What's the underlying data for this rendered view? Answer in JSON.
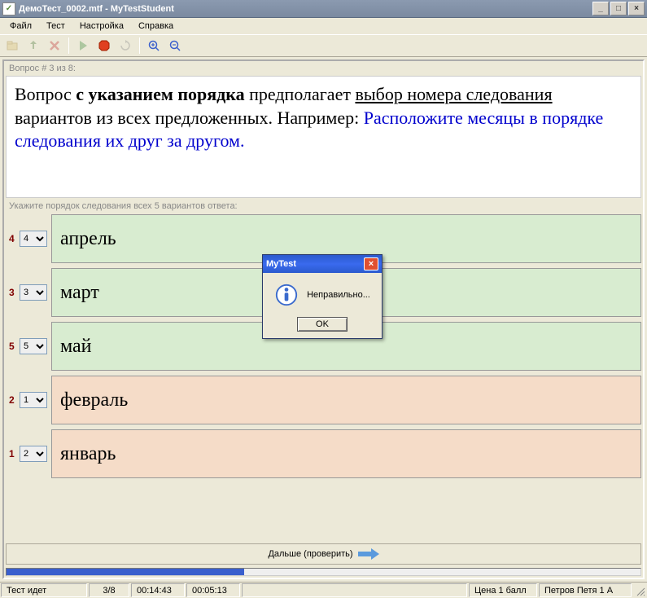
{
  "window": {
    "title": "ДемоТест_0002.mtf - MyTestStudent"
  },
  "menu": {
    "file": "Файл",
    "test": "Тест",
    "settings": "Настройка",
    "help": "Справка"
  },
  "question": {
    "counter": "Вопрос # 3 из 8:",
    "part1": "Вопрос ",
    "bold": "с указанием порядка",
    "part2": " предполагает ",
    "uline1": "выбор номера следования",
    "part3": " вариантов из всех предложенных. Например: ",
    "blue": "Расположите месяцы в порядке следования их друг за другом.",
    "instruction": "Укажите порядок следования всех 5 вариантов ответа:"
  },
  "answers": [
    {
      "idx": "4",
      "val": "4",
      "text": "апрель",
      "correct": true
    },
    {
      "idx": "3",
      "val": "3",
      "text": "март",
      "correct": true
    },
    {
      "idx": "5",
      "val": "5",
      "text": "май",
      "correct": true
    },
    {
      "idx": "2",
      "val": "1",
      "text": "февраль",
      "correct": false
    },
    {
      "idx": "1",
      "val": "2",
      "text": "январь",
      "correct": false
    }
  ],
  "next_button": "Дальше (проверить)",
  "modal": {
    "title": "MyTest",
    "message": "Неправильно...",
    "ok": "OK"
  },
  "status": {
    "state": "Тест идет",
    "progress": "3/8",
    "time1": "00:14:43",
    "time2": "00:05:13",
    "price": "Цена 1 балл",
    "user": "Петров Петя 1 А"
  }
}
